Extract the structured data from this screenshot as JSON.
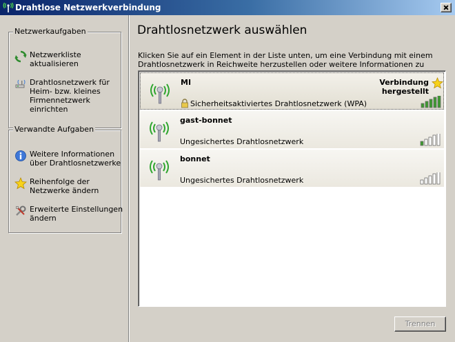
{
  "window": {
    "title": "Drahtlose Netzwerkverbindung"
  },
  "sidebar": {
    "network_tasks": {
      "title": "Netzwerkaufgaben",
      "items": [
        {
          "label": "Netzwerkliste aktualisieren",
          "icon": "refresh-icon"
        },
        {
          "label": "Drahtlosnetzwerk für Heim- bzw. kleines Firmennetzwerk einrichten",
          "icon": "setup-wizard-icon"
        }
      ]
    },
    "related_tasks": {
      "title": "Verwandte Aufgaben",
      "items": [
        {
          "label": "Weitere Informationen über Drahtlosnetzwerke",
          "icon": "info-icon"
        },
        {
          "label": "Reihenfolge der Netzwerke ändern",
          "icon": "star-icon"
        },
        {
          "label": "Erweiterte Einstellungen ändern",
          "icon": "settings-icon"
        }
      ]
    }
  },
  "main": {
    "heading": "Drahtlosnetzwerk auswählen",
    "intro": "Klicken Sie auf ein Element in der Liste unten, um eine Verbindung mit einem Drahtlosnetzwerk in Reichweite herzustellen oder weitere Informationen zu erhalten.",
    "networks": [
      {
        "name": "MI",
        "security": "Sicherheitsaktiviertes Drahtlosnetzwerk (WPA)",
        "status": "Verbindung hergestellt",
        "secured": true,
        "signal_bars": 5,
        "selected": true
      },
      {
        "name": "gast-bonnet",
        "security": "Ungesichertes Drahtlosnetzwerk",
        "status": "",
        "secured": false,
        "signal_bars": 1,
        "selected": false
      },
      {
        "name": "bonnet",
        "security": "Ungesichertes Drahtlosnetzwerk",
        "status": "",
        "secured": false,
        "signal_bars": 0,
        "selected": false
      }
    ],
    "disconnect_label": "Trennen"
  },
  "colors": {
    "titlebar_start": "#0a246a",
    "titlebar_end": "#a6caf0",
    "signal_on": "#3c9a2e",
    "signal_off": "#ffffff",
    "antenna_waves": "#2fa52f"
  }
}
